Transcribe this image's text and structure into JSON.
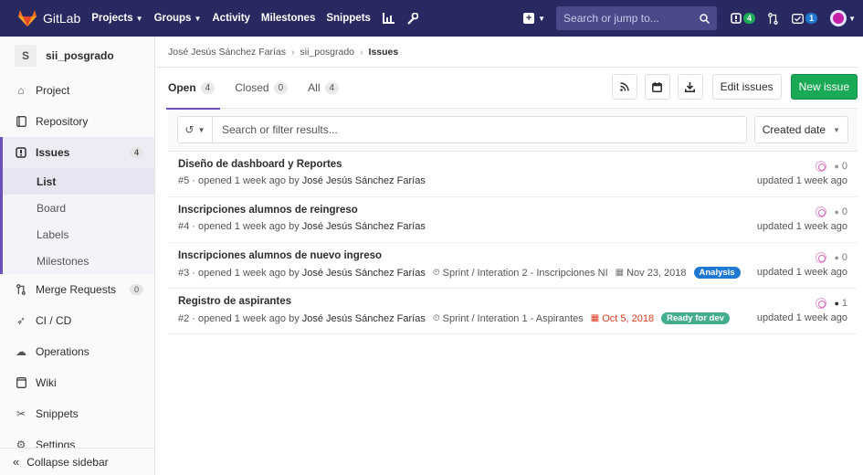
{
  "navbar": {
    "brand": "GitLab",
    "links": [
      "Projects",
      "Groups",
      "Activity",
      "Milestones",
      "Snippets"
    ],
    "search_placeholder": "Search or jump to...",
    "issues_count": "4",
    "todos_count": "1"
  },
  "sidebar": {
    "project_initial": "S",
    "project_name": "sii_posgrado",
    "items": {
      "project": "Project",
      "repository": "Repository",
      "issues": "Issues",
      "issues_count": "4",
      "merge_requests": "Merge Requests",
      "mr_count": "0",
      "cicd": "CI / CD",
      "operations": "Operations",
      "wiki": "Wiki",
      "snippets": "Snippets",
      "settings": "Settings"
    },
    "sub_items": {
      "list": "List",
      "board": "Board",
      "labels": "Labels",
      "milestones": "Milestones"
    },
    "collapse": "Collapse sidebar"
  },
  "breadcrumb": {
    "user": "José Jesús Sánchez Farías",
    "project": "sii_posgrado",
    "current": "Issues"
  },
  "tabs": {
    "open": "Open",
    "open_count": "4",
    "closed": "Closed",
    "closed_count": "0",
    "all": "All",
    "all_count": "4"
  },
  "actions": {
    "edit_issues": "Edit issues",
    "new_issue": "New issue"
  },
  "filter": {
    "placeholder": "Search or filter results...",
    "sort": "Created date"
  },
  "issues": [
    {
      "title": "Diseño de dashboard y Reportes",
      "meta": "#5 · opened 1 week ago by",
      "author": "José Jesús Sánchez Farías",
      "comments": "0",
      "updated": "updated 1 week ago"
    },
    {
      "title": "Inscripciones alumnos de reingreso",
      "meta": "#4 · opened 1 week ago by",
      "author": "José Jesús Sánchez Farías",
      "comments": "0",
      "updated": "updated 1 week ago"
    },
    {
      "title": "Inscripciones alumnos de nuevo ingreso",
      "meta": "#3 · opened 1 week ago by",
      "author": "José Jesús Sánchez Farías",
      "milestone": "Sprint / Interation 2 - Inscripciones NI",
      "due": "Nov 23, 2018",
      "label": "Analysis",
      "comments": "0",
      "updated": "updated 1 week ago"
    },
    {
      "title": "Registro de aspirantes",
      "meta": "#2 · opened 1 week ago by",
      "author": "José Jesús Sánchez Farías",
      "milestone": "Sprint / Interation 1 - Aspirantes",
      "due": "Oct 5, 2018",
      "label": "Ready for dev",
      "comments": "1",
      "updated": "updated 1 week ago"
    }
  ]
}
